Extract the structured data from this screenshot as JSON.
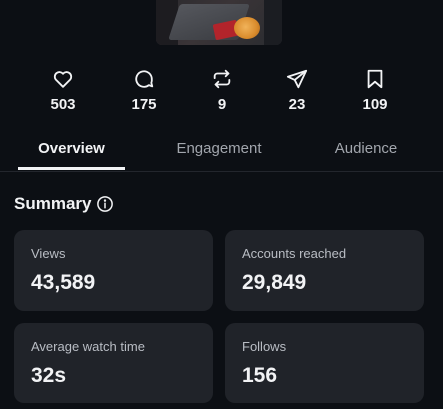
{
  "post": {
    "thumbnail_alt": "post thumbnail"
  },
  "stats": [
    {
      "icon": "heart-icon",
      "value": "503"
    },
    {
      "icon": "comment-icon",
      "value": "175"
    },
    {
      "icon": "repost-icon",
      "value": "9"
    },
    {
      "icon": "share-icon",
      "value": "23"
    },
    {
      "icon": "bookmark-icon",
      "value": "109"
    }
  ],
  "tabs": {
    "overview": "Overview",
    "engagement": "Engagement",
    "audience": "Audience"
  },
  "summary": {
    "title": "Summary",
    "cards": [
      {
        "label": "Views",
        "value": "43,589"
      },
      {
        "label": "Accounts reached",
        "value": "29,849"
      },
      {
        "label": "Average watch time",
        "value": "32s"
      },
      {
        "label": "Follows",
        "value": "156"
      }
    ]
  },
  "colors": {
    "background": "#0c0f14",
    "card": "#202329",
    "text_primary": "#f2f3f5",
    "text_secondary": "#a2a6ad"
  }
}
